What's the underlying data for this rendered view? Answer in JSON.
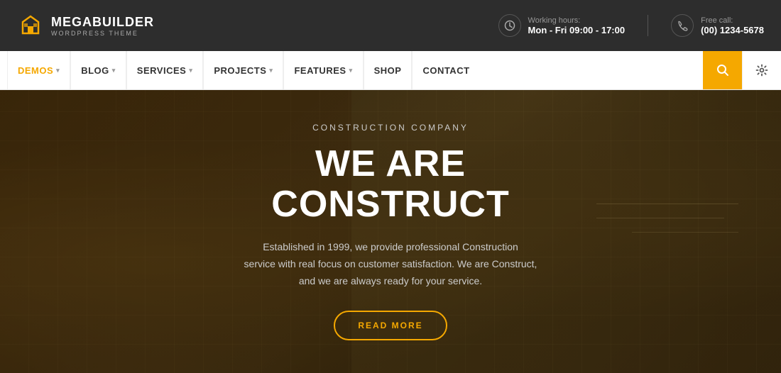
{
  "topbar": {
    "logo_title": "MEGABUILDER",
    "logo_subtitle": "WORDPRESS THEME",
    "working_hours_label": "Working hours:",
    "working_hours_value": "Mon - Fri 09:00 - 17:00",
    "free_call_label": "Free call:",
    "free_call_value": "(00) 1234-5678"
  },
  "nav": {
    "items": [
      {
        "label": "DEMOS",
        "has_dropdown": true,
        "active": true
      },
      {
        "label": "BLOG",
        "has_dropdown": true,
        "active": false
      },
      {
        "label": "SERVICES",
        "has_dropdown": true,
        "active": false
      },
      {
        "label": "PROJECTS",
        "has_dropdown": true,
        "active": false
      },
      {
        "label": "FEATURES",
        "has_dropdown": true,
        "active": false
      },
      {
        "label": "SHOP",
        "has_dropdown": false,
        "active": false
      },
      {
        "label": "CONTACT",
        "has_dropdown": false,
        "active": false
      }
    ],
    "search_icon": "🔍",
    "settings_icon": "⚙"
  },
  "hero": {
    "sub_title": "CONSTRUCTION COMPANY",
    "title": "WE ARE CONSTRUCT",
    "description": "Established in 1999, we provide professional Construction\nservice with real focus on customer satisfaction. We are Construct,\nand we are always ready for your service.",
    "cta_label": "READ MORE"
  },
  "colors": {
    "accent": "#f5a800",
    "dark_bar": "#2d2d2d"
  }
}
